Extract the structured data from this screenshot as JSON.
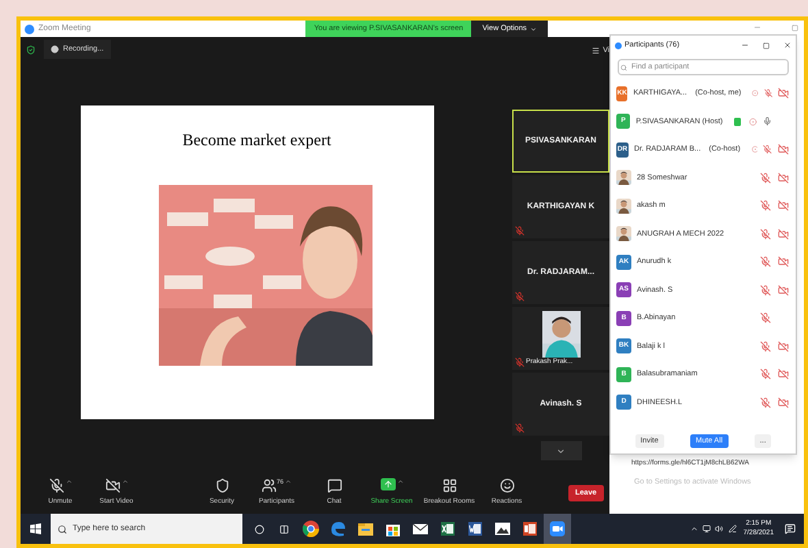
{
  "window": {
    "title": "Zoom Meeting"
  },
  "banner": {
    "text": "You are viewing P.SIVASANKARAN's screen",
    "button": "View Options"
  },
  "top_bar": {
    "recording": "Recording...",
    "view": "Vi"
  },
  "slide": {
    "title": "Become market expert"
  },
  "thumbnails": [
    {
      "name": "PSIVASANKARAN",
      "kind": "name",
      "selected": true,
      "muted": false
    },
    {
      "name": "KARTHIGAYAN K",
      "kind": "name",
      "selected": false,
      "muted": true
    },
    {
      "name": "Dr. RADJARAM...",
      "kind": "name",
      "selected": false,
      "muted": true
    },
    {
      "name": "Prakash Prak...",
      "kind": "video",
      "selected": false,
      "muted": true
    },
    {
      "name": "Avinash. S",
      "kind": "name",
      "selected": false,
      "muted": true
    }
  ],
  "participants_panel": {
    "title": "Participants (76)",
    "search": {
      "placeholder": "Find a participant"
    },
    "participants": [
      {
        "name": "KARTHIGAYA...",
        "role": "(Co-host, me)",
        "avatar": {
          "kind": "initials",
          "text": "KK",
          "color": "#e8702a"
        },
        "sharing": false,
        "status_icon": true,
        "mic_muted": true,
        "video_off": true
      },
      {
        "name": "P.SIVASANKARAN (Host)",
        "avatar": {
          "kind": "initials",
          "text": "P",
          "color": "#2fb457"
        },
        "sharing": true,
        "status_icon": true,
        "mic_muted": false,
        "video_off": false
      },
      {
        "name": "Dr. RADJARAM B...",
        "role": "(Co-host)",
        "avatar": {
          "kind": "initials",
          "text": "DR",
          "color": "#2c5f8a"
        },
        "sharing": false,
        "status_icon": true,
        "mic_muted": true,
        "video_off": true
      },
      {
        "name": "28 Someshwar",
        "sharing": false,
        "status_icon": false,
        "mic_muted": true,
        "video_off": true
      },
      {
        "name": "akash m",
        "sharing": false,
        "status_icon": false,
        "mic_muted": true,
        "video_off": true
      },
      {
        "name": "ANUGRAH A MECH 2022",
        "sharing": false,
        "status_icon": false,
        "mic_muted": true,
        "video_off": true
      },
      {
        "name": "Anurudh k",
        "avatar": {
          "kind": "initials",
          "text": "AK",
          "color": "#2f7fc1"
        },
        "sharing": false,
        "status_icon": false,
        "mic_muted": true,
        "video_off": true
      },
      {
        "name": "Avinash. S",
        "avatar": {
          "kind": "initials",
          "text": "AS",
          "color": "#8a3fb5"
        },
        "sharing": false,
        "status_icon": false,
        "mic_muted": true,
        "video_off": true
      },
      {
        "name": "B.Abinayan",
        "avatar": {
          "kind": "initials",
          "text": "B",
          "color": "#8a3fb5"
        },
        "sharing": false,
        "status_icon": false,
        "mic_muted": true,
        "video_off": false
      },
      {
        "name": "Balaji k l",
        "avatar": {
          "kind": "initials",
          "text": "BK",
          "color": "#2f7fc1"
        },
        "sharing": false,
        "status_icon": false,
        "mic_muted": true,
        "video_off": true
      },
      {
        "name": "Balasubramaniam",
        "avatar": {
          "kind": "initials",
          "text": "B",
          "color": "#2fb457"
        },
        "sharing": false,
        "status_icon": false,
        "mic_muted": true,
        "video_off": true
      },
      {
        "name": "DHINEESH.L",
        "avatar": {
          "kind": "initials",
          "text": "D",
          "color": "#2f7fc1"
        },
        "sharing": false,
        "status_icon": false,
        "mic_muted": true,
        "video_off": true
      }
    ],
    "buttons": [
      {
        "label": "Invite",
        "kind": "plain"
      },
      {
        "label": "Mute All",
        "kind": "primary"
      },
      {
        "label": "...",
        "kind": "plain"
      }
    ]
  },
  "link": "https://forms.gle/hl6CT1jM8chLB62WA",
  "activation_notice": "Go to Settings to activate Windows",
  "toolbar": {
    "items": [
      {
        "kind": "mic",
        "label": "Unmute",
        "caret": true
      },
      {
        "kind": "video",
        "label": "Start Video",
        "caret": true
      },
      {
        "kind": "security",
        "label": "Security",
        "caret": false
      },
      {
        "kind": "participants",
        "label": "Participants",
        "count": "76",
        "caret": true
      },
      {
        "kind": "chat",
        "label": "Chat",
        "caret": false
      },
      {
        "kind": "share",
        "label": "Share Screen",
        "caret": true
      },
      {
        "kind": "breakout",
        "label": "Breakout Rooms",
        "caret": false
      },
      {
        "kind": "reactions",
        "label": "Reactions",
        "caret": false
      }
    ],
    "leave": "Leave"
  },
  "taskbar": {
    "search": {
      "placeholder": "Type here to search"
    },
    "apps": [
      {
        "kind": "chrome",
        "active": false
      },
      {
        "kind": "edge",
        "active": false
      },
      {
        "kind": "explorer",
        "active": false
      },
      {
        "kind": "store",
        "active": false
      },
      {
        "kind": "mail",
        "active": false
      },
      {
        "kind": "excel",
        "active": false
      },
      {
        "kind": "word",
        "active": false
      },
      {
        "kind": "photos",
        "active": false
      },
      {
        "kind": "powerpoint",
        "active": false
      },
      {
        "kind": "zoom",
        "active": true
      }
    ],
    "time": "2:15 PM",
    "date": "7/28/2021"
  }
}
